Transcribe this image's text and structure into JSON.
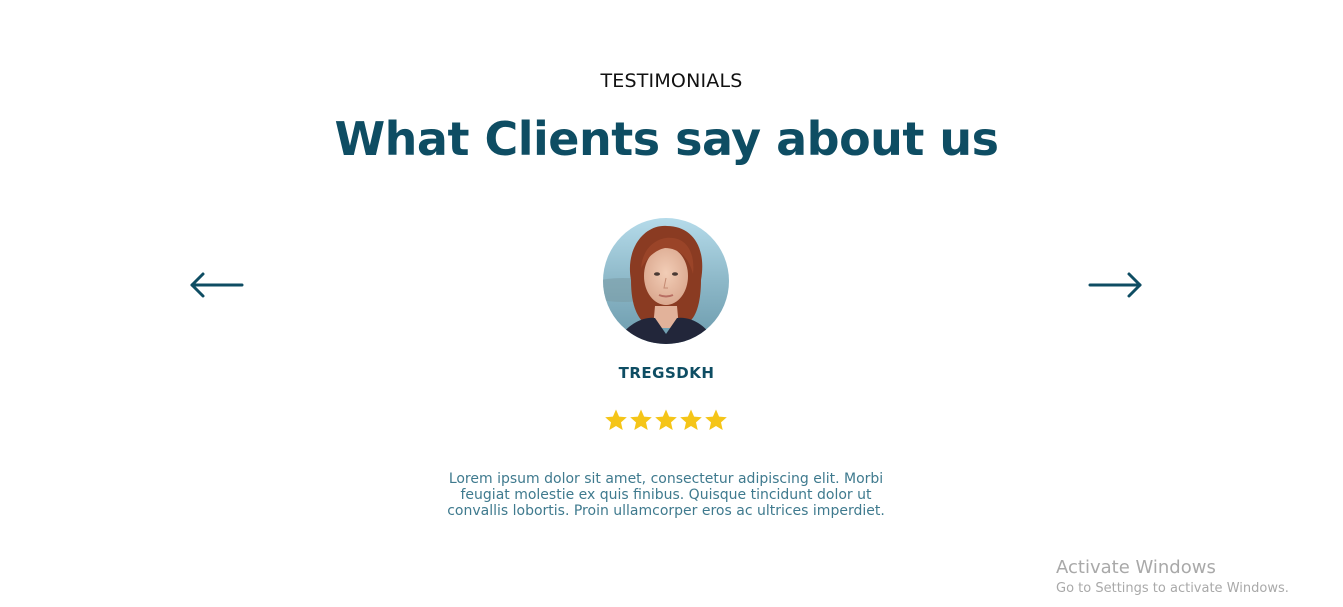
{
  "section": {
    "eyebrow": "TESTIMONIALS",
    "title": "What Clients say about us"
  },
  "carousel": {
    "prev_icon": "arrow-left-icon",
    "next_icon": "arrow-right-icon",
    "accent_color": "#0e4d63"
  },
  "testimonial": {
    "name": "TREGSDKH",
    "rating": 5,
    "rating_max": 5,
    "star_color": "#f5c518",
    "text": "Lorem ipsum dolor sit amet, consectetur adipiscing elit. Morbi feugiat molestie ex quis finibus. Quisque tincidunt dolor ut convallis lobortis. Proin ullamcorper eros ac ultrices imperdiet."
  },
  "watermark": {
    "title": "Activate Windows",
    "subtitle": "Go to Settings to activate Windows."
  }
}
